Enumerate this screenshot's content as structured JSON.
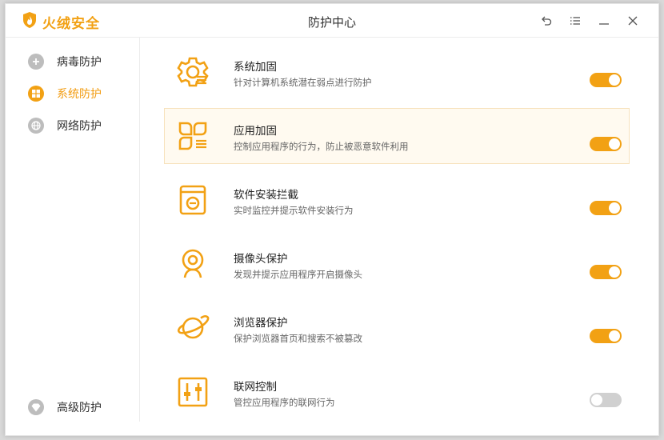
{
  "app": {
    "brand": "火绒安全",
    "window_title": "防护中心"
  },
  "colors": {
    "accent": "#f2a114",
    "toggle_off": "#d0d0d0",
    "nav_inactive": "#bdbdbd"
  },
  "title_controls": [
    {
      "icon": "undo-icon"
    },
    {
      "icon": "menu-icon"
    },
    {
      "icon": "minimize-icon"
    },
    {
      "icon": "close-icon"
    }
  ],
  "sidebar": {
    "items": [
      {
        "label": "病毒防护",
        "icon": "plus-icon",
        "active": false
      },
      {
        "label": "系统防护",
        "icon": "windows-icon",
        "active": true
      },
      {
        "label": "网络防护",
        "icon": "globe-icon",
        "active": false
      }
    ],
    "bottom_item": {
      "label": "高级防护",
      "icon": "diamond-icon"
    }
  },
  "protections": [
    {
      "title": "系统加固",
      "desc": "针对计算机系统潜在弱点进行防护",
      "icon": "gear-shield-icon",
      "enabled": true,
      "highlighted": false
    },
    {
      "title": "应用加固",
      "desc": "控制应用程序的行为，防止被恶意软件利用",
      "icon": "app-grid-icon",
      "enabled": true,
      "highlighted": true
    },
    {
      "title": "软件安装拦截",
      "desc": "实时监控并提示软件安装行为",
      "icon": "install-block-icon",
      "enabled": true,
      "highlighted": false
    },
    {
      "title": "摄像头保护",
      "desc": "发现并提示应用程序开启摄像头",
      "icon": "webcam-icon",
      "enabled": true,
      "highlighted": false
    },
    {
      "title": "浏览器保护",
      "desc": "保护浏览器首页和搜索不被篡改",
      "icon": "planet-icon",
      "enabled": true,
      "highlighted": false
    },
    {
      "title": "联网控制",
      "desc": "管控应用程序的联网行为",
      "icon": "sliders-icon",
      "enabled": false,
      "highlighted": false
    }
  ]
}
